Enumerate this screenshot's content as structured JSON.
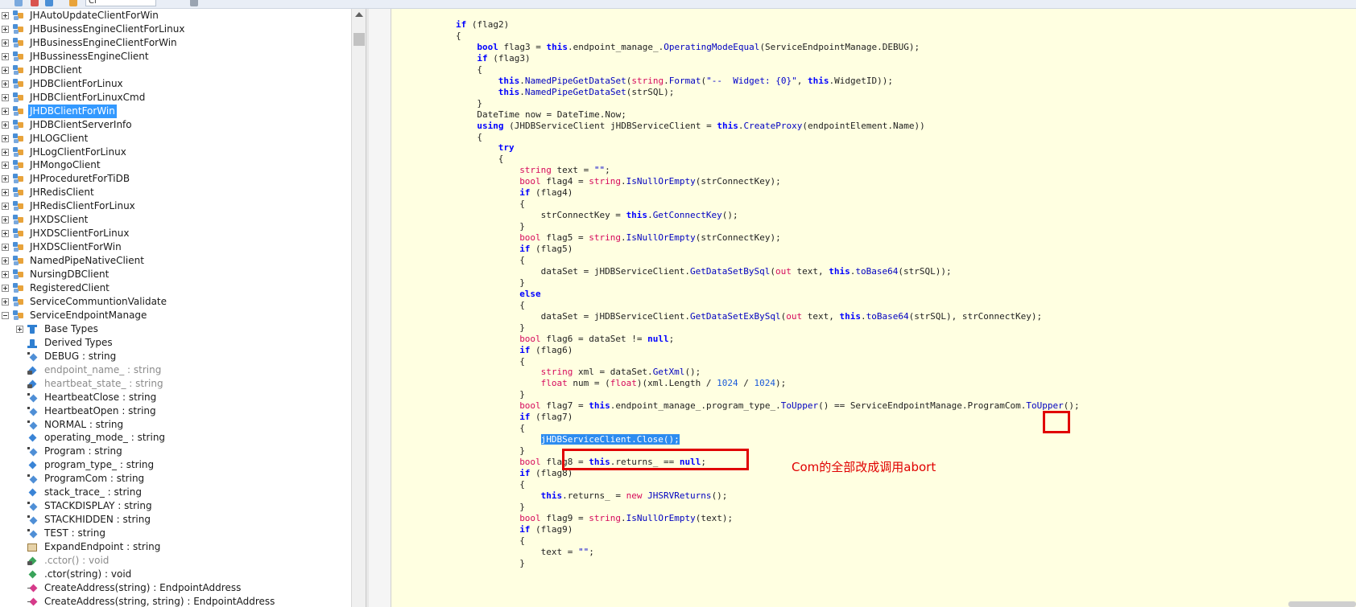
{
  "toolbar": {
    "search_value": "Cl"
  },
  "tree": {
    "items": [
      {
        "label": "JHAutoUpdateClientForWin",
        "kind": "namespace",
        "expander": "plus"
      },
      {
        "label": "JHBusinessEngineClientForLinux",
        "kind": "namespace",
        "expander": "plus"
      },
      {
        "label": "JHBusinessEngineClientForWin",
        "kind": "namespace",
        "expander": "plus"
      },
      {
        "label": "JHBussinessEngineClient",
        "kind": "namespace",
        "expander": "plus"
      },
      {
        "label": "JHDBClient",
        "kind": "namespace",
        "expander": "plus"
      },
      {
        "label": "JHDBClientForLinux",
        "kind": "namespace",
        "expander": "plus"
      },
      {
        "label": "JHDBClientForLinuxCmd",
        "kind": "namespace",
        "expander": "plus"
      },
      {
        "label": "JHDBClientForWin",
        "kind": "namespace",
        "expander": "plus",
        "selected": true
      },
      {
        "label": "JHDBClientServerInfo",
        "kind": "namespace",
        "expander": "plus"
      },
      {
        "label": "JHLOGClient",
        "kind": "namespace",
        "expander": "plus"
      },
      {
        "label": "JHLogClientForLinux",
        "kind": "namespace",
        "expander": "plus"
      },
      {
        "label": "JHMongoClient",
        "kind": "namespace",
        "expander": "plus"
      },
      {
        "label": "JHProceduretForTiDB",
        "kind": "namespace",
        "expander": "plus"
      },
      {
        "label": "JHRedisClient",
        "kind": "namespace",
        "expander": "plus"
      },
      {
        "label": "JHRedisClientForLinux",
        "kind": "namespace",
        "expander": "plus"
      },
      {
        "label": "JHXDSClient",
        "kind": "namespace",
        "expander": "plus"
      },
      {
        "label": "JHXDSClientForLinux",
        "kind": "namespace",
        "expander": "plus"
      },
      {
        "label": "JHXDSClientForWin",
        "kind": "namespace",
        "expander": "plus"
      },
      {
        "label": "NamedPipeNativeClient",
        "kind": "namespace",
        "expander": "plus"
      },
      {
        "label": "NursingDBClient",
        "kind": "namespace",
        "expander": "plus"
      },
      {
        "label": "RegisteredClient",
        "kind": "namespace",
        "expander": "plus"
      },
      {
        "label": "ServiceCommuntionValidate",
        "kind": "namespace",
        "expander": "plus"
      },
      {
        "label": "ServiceEndpointManage",
        "kind": "namespace",
        "expander": "minus"
      },
      {
        "label": "Base Types",
        "kind": "base-types",
        "expander": "plus",
        "child": true
      },
      {
        "label": "Derived Types",
        "kind": "derived-types",
        "child": true
      },
      {
        "label": "DEBUG : string",
        "kind": "const",
        "child": true
      },
      {
        "label": "endpoint_name_ : string",
        "kind": "private-field",
        "child": true,
        "gray": true
      },
      {
        "label": "heartbeat_state_ : string",
        "kind": "private-field",
        "child": true,
        "gray": true
      },
      {
        "label": "HeartbeatClose : string",
        "kind": "const",
        "child": true
      },
      {
        "label": "HeartbeatOpen : string",
        "kind": "const",
        "child": true
      },
      {
        "label": "NORMAL : string",
        "kind": "const",
        "child": true
      },
      {
        "label": "operating_mode_ : string",
        "kind": "field",
        "child": true
      },
      {
        "label": "Program : string",
        "kind": "const",
        "child": true
      },
      {
        "label": "program_type_ : string",
        "kind": "field",
        "child": true
      },
      {
        "label": "ProgramCom : string",
        "kind": "const",
        "child": true
      },
      {
        "label": "stack_trace_ : string",
        "kind": "field",
        "child": true
      },
      {
        "label": "STACKDISPLAY : string",
        "kind": "const",
        "child": true
      },
      {
        "label": "STACKHIDDEN : string",
        "kind": "const",
        "child": true
      },
      {
        "label": "TEST : string",
        "kind": "const",
        "child": true
      },
      {
        "label": "ExpandEndpoint : string",
        "kind": "property",
        "child": true
      },
      {
        "label": ".cctor() : void",
        "kind": "static-method",
        "child": true,
        "gray": true
      },
      {
        "label": ".ctor(string) : void",
        "kind": "method",
        "child": true
      },
      {
        "label": "CreateAddress(string) : EndpointAddress",
        "kind": "ext-method",
        "child": true
      },
      {
        "label": "CreateAddress(string, string) : EndpointAddress",
        "kind": "ext-method",
        "child": true
      }
    ]
  },
  "code": {
    "lines": [
      {
        "indent": 0,
        "tokens": [
          [
            "kw",
            "if"
          ],
          [
            "t",
            " (flag2)"
          ]
        ]
      },
      {
        "indent": 0,
        "tokens": [
          [
            "t",
            "{"
          ]
        ]
      },
      {
        "indent": 1,
        "tokens": [
          [
            "kw",
            "bool"
          ],
          [
            "t",
            " flag3 = "
          ],
          [
            "kw",
            "this"
          ],
          [
            "t",
            ".endpoint_manage_."
          ],
          [
            "mth",
            "OperatingModeEqual"
          ],
          [
            "t",
            "(ServiceEndpointManage.DEBUG);"
          ]
        ]
      },
      {
        "indent": 1,
        "tokens": [
          [
            "kw",
            "if"
          ],
          [
            "t",
            " (flag3)"
          ]
        ]
      },
      {
        "indent": 1,
        "tokens": [
          [
            "t",
            "{"
          ]
        ]
      },
      {
        "indent": 2,
        "tokens": [
          [
            "kw",
            "this"
          ],
          [
            "t",
            "."
          ],
          [
            "mth",
            "NamedPipeGetDataSet"
          ],
          [
            "t",
            "("
          ],
          [
            "kw2",
            "string"
          ],
          [
            "t",
            "."
          ],
          [
            "mth",
            "Format"
          ],
          [
            "t",
            "("
          ],
          [
            "str",
            "\"--  Widget: {0}\""
          ],
          [
            "t",
            ", "
          ],
          [
            "kw",
            "this"
          ],
          [
            "t",
            ".WidgetID));"
          ]
        ]
      },
      {
        "indent": 2,
        "tokens": [
          [
            "kw",
            "this"
          ],
          [
            "t",
            "."
          ],
          [
            "mth",
            "NamedPipeGetDataSet"
          ],
          [
            "t",
            "(strSQL);"
          ]
        ]
      },
      {
        "indent": 1,
        "tokens": [
          [
            "t",
            "}"
          ]
        ]
      },
      {
        "indent": 1,
        "tokens": [
          [
            "t",
            "DateTime now = DateTime.Now;"
          ]
        ]
      },
      {
        "indent": 1,
        "tokens": [
          [
            "kw",
            "using"
          ],
          [
            "t",
            " (JHDBServiceClient jHDBServiceClient = "
          ],
          [
            "kw",
            "this"
          ],
          [
            "t",
            "."
          ],
          [
            "mth",
            "CreateProxy"
          ],
          [
            "t",
            "(endpointElement.Name))"
          ]
        ]
      },
      {
        "indent": 1,
        "tokens": [
          [
            "t",
            "{"
          ]
        ]
      },
      {
        "indent": 2,
        "tokens": [
          [
            "kw",
            "try"
          ]
        ]
      },
      {
        "indent": 2,
        "tokens": [
          [
            "t",
            "{"
          ]
        ]
      },
      {
        "indent": 3,
        "tokens": [
          [
            "kw2",
            "string"
          ],
          [
            "t",
            " text = "
          ],
          [
            "str",
            "\"\""
          ],
          [
            "t",
            ";"
          ]
        ]
      },
      {
        "indent": 3,
        "tokens": [
          [
            "kw2",
            "bool"
          ],
          [
            "t",
            " flag4 = "
          ],
          [
            "kw2",
            "string"
          ],
          [
            "t",
            "."
          ],
          [
            "mth",
            "IsNullOrEmpty"
          ],
          [
            "t",
            "(strConnectKey);"
          ]
        ]
      },
      {
        "indent": 3,
        "tokens": [
          [
            "kw",
            "if"
          ],
          [
            "t",
            " (flag4)"
          ]
        ]
      },
      {
        "indent": 3,
        "tokens": [
          [
            "t",
            "{"
          ]
        ]
      },
      {
        "indent": 4,
        "tokens": [
          [
            "t",
            "strConnectKey = "
          ],
          [
            "kw",
            "this"
          ],
          [
            "t",
            "."
          ],
          [
            "mth",
            "GetConnectKey"
          ],
          [
            "t",
            "();"
          ]
        ]
      },
      {
        "indent": 3,
        "tokens": [
          [
            "t",
            "}"
          ]
        ]
      },
      {
        "indent": 3,
        "tokens": [
          [
            "kw2",
            "bool"
          ],
          [
            "t",
            " flag5 = "
          ],
          [
            "kw2",
            "string"
          ],
          [
            "t",
            "."
          ],
          [
            "mth",
            "IsNullOrEmpty"
          ],
          [
            "t",
            "(strConnectKey);"
          ]
        ]
      },
      {
        "indent": 3,
        "tokens": [
          [
            "kw",
            "if"
          ],
          [
            "t",
            " (flag5)"
          ]
        ]
      },
      {
        "indent": 3,
        "tokens": [
          [
            "t",
            "{"
          ]
        ]
      },
      {
        "indent": 4,
        "tokens": [
          [
            "t",
            "dataSet = jHDBServiceClient."
          ],
          [
            "mth",
            "GetDataSetBySql"
          ],
          [
            "t",
            "("
          ],
          [
            "kw2",
            "out"
          ],
          [
            "t",
            " text, "
          ],
          [
            "kw",
            "this"
          ],
          [
            "t",
            "."
          ],
          [
            "mth",
            "toBase64"
          ],
          [
            "t",
            "(strSQL));"
          ]
        ]
      },
      {
        "indent": 3,
        "tokens": [
          [
            "t",
            "}"
          ]
        ]
      },
      {
        "indent": 3,
        "tokens": [
          [
            "kw",
            "else"
          ]
        ]
      },
      {
        "indent": 3,
        "tokens": [
          [
            "t",
            "{"
          ]
        ]
      },
      {
        "indent": 4,
        "tokens": [
          [
            "t",
            "dataSet = jHDBServiceClient."
          ],
          [
            "mth",
            "GetDataSetExBySql"
          ],
          [
            "t",
            "("
          ],
          [
            "kw2",
            "out"
          ],
          [
            "t",
            " text, "
          ],
          [
            "kw",
            "this"
          ],
          [
            "t",
            "."
          ],
          [
            "mth",
            "toBase64"
          ],
          [
            "t",
            "(strSQL), strConnectKey);"
          ]
        ]
      },
      {
        "indent": 3,
        "tokens": [
          [
            "t",
            "}"
          ]
        ]
      },
      {
        "indent": 3,
        "tokens": [
          [
            "kw2",
            "bool"
          ],
          [
            "t",
            " flag6 = dataSet != "
          ],
          [
            "kw",
            "null"
          ],
          [
            "t",
            ";"
          ]
        ]
      },
      {
        "indent": 3,
        "tokens": [
          [
            "kw",
            "if"
          ],
          [
            "t",
            " (flag6)"
          ]
        ]
      },
      {
        "indent": 3,
        "tokens": [
          [
            "t",
            "{"
          ]
        ]
      },
      {
        "indent": 4,
        "tokens": [
          [
            "kw2",
            "string"
          ],
          [
            "t",
            " xml = dataSet."
          ],
          [
            "mth",
            "GetXml"
          ],
          [
            "t",
            "();"
          ]
        ]
      },
      {
        "indent": 4,
        "tokens": [
          [
            "kw2",
            "float"
          ],
          [
            "t",
            " num = ("
          ],
          [
            "kw2",
            "float"
          ],
          [
            "t",
            ")(xml.Length / "
          ],
          [
            "num",
            "1024"
          ],
          [
            "t",
            " / "
          ],
          [
            "num",
            "1024"
          ],
          [
            "t",
            ");"
          ]
        ]
      },
      {
        "indent": 3,
        "tokens": [
          [
            "t",
            "}"
          ]
        ]
      },
      {
        "indent": 3,
        "tokens": [
          [
            "kw2",
            "bool"
          ],
          [
            "t",
            " flag7 = "
          ],
          [
            "kw",
            "this"
          ],
          [
            "t",
            ".endpoint_manage_.program_type_."
          ],
          [
            "mth",
            "ToUpper"
          ],
          [
            "t",
            "() == ServiceEndpointManage.ProgramCom."
          ],
          [
            "mth",
            "ToUpper"
          ],
          [
            "t",
            "();"
          ]
        ]
      },
      {
        "indent": 3,
        "tokens": [
          [
            "kw",
            "if"
          ],
          [
            "t",
            " (flag7)"
          ]
        ]
      },
      {
        "indent": 3,
        "tokens": [
          [
            "t",
            "{"
          ]
        ]
      },
      {
        "indent": 4,
        "tokens": [
          [
            "hl",
            "jHDBServiceClient.Close();"
          ]
        ]
      },
      {
        "indent": 3,
        "tokens": [
          [
            "t",
            "}"
          ]
        ]
      },
      {
        "indent": 3,
        "tokens": [
          [
            "kw2",
            "bool"
          ],
          [
            "t",
            " flag8 = "
          ],
          [
            "kw",
            "this"
          ],
          [
            "t",
            ".returns_ == "
          ],
          [
            "kw",
            "null"
          ],
          [
            "t",
            ";"
          ]
        ]
      },
      {
        "indent": 3,
        "tokens": [
          [
            "kw",
            "if"
          ],
          [
            "t",
            " (flag8)"
          ]
        ]
      },
      {
        "indent": 3,
        "tokens": [
          [
            "t",
            "{"
          ]
        ]
      },
      {
        "indent": 4,
        "tokens": [
          [
            "kw",
            "this"
          ],
          [
            "t",
            ".returns_ = "
          ],
          [
            "kw2",
            "new"
          ],
          [
            "t",
            " "
          ],
          [
            "mth",
            "JHSRVReturns"
          ],
          [
            "t",
            "();"
          ]
        ]
      },
      {
        "indent": 3,
        "tokens": [
          [
            "t",
            "}"
          ]
        ]
      },
      {
        "indent": 3,
        "tokens": [
          [
            "kw2",
            "bool"
          ],
          [
            "t",
            " flag9 = "
          ],
          [
            "kw2",
            "string"
          ],
          [
            "t",
            "."
          ],
          [
            "mth",
            "IsNullOrEmpty"
          ],
          [
            "t",
            "(text);"
          ]
        ]
      },
      {
        "indent": 3,
        "tokens": [
          [
            "kw",
            "if"
          ],
          [
            "t",
            " (flag9)"
          ]
        ]
      },
      {
        "indent": 3,
        "tokens": [
          [
            "t",
            "{"
          ]
        ]
      },
      {
        "indent": 4,
        "tokens": [
          [
            "t",
            "text = "
          ],
          [
            "str",
            "\"\""
          ],
          [
            "t",
            ";"
          ]
        ]
      },
      {
        "indent": 3,
        "tokens": [
          [
            "t",
            "}"
          ]
        ]
      }
    ]
  },
  "annotation": {
    "text": "Com的全部改成调用abort"
  },
  "colors": {
    "code_bg": "#ffffe1",
    "selection": "#3399ff",
    "annotation": "#e00000"
  }
}
